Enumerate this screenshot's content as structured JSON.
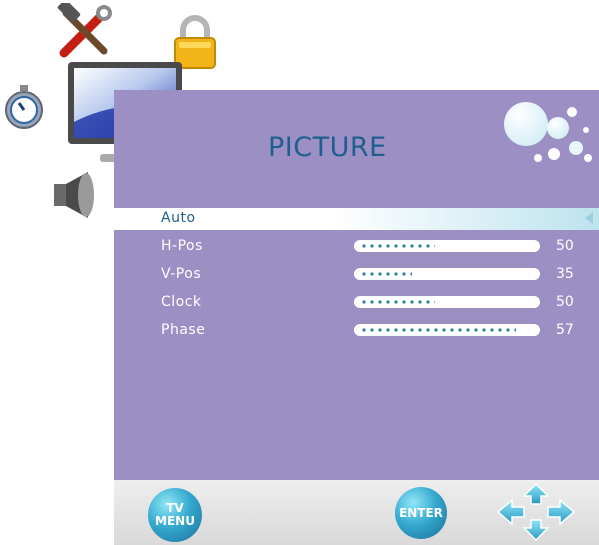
{
  "menu": {
    "title": "PICTURE",
    "items": [
      {
        "label": "Auto",
        "selected": true
      },
      {
        "label": "H-Pos",
        "value": "50",
        "level": 50
      },
      {
        "label": "V-Pos",
        "value": "35",
        "level": 35
      },
      {
        "label": "Clock",
        "value": "50",
        "level": 50
      },
      {
        "label": "Phase",
        "value": "57",
        "level": 57
      }
    ]
  },
  "buttons": {
    "tv_menu_line1": "TV",
    "tv_menu_line2": "MENU",
    "enter": "ENTER"
  },
  "icons": {
    "tools": "tools-icon",
    "lock": "lock-icon",
    "timer": "stopwatch-icon",
    "picture": "monitor-icon",
    "sound": "speaker-icon",
    "navigation": "direction-pad-icon",
    "decoration": "bubbles-icon"
  },
  "colors": {
    "panel": "#9b8fc4",
    "title": "#1f5f8f",
    "highlight": "#ffffff",
    "slider_dots": "#2e7ea8",
    "button_orb": "#35a9cf"
  }
}
